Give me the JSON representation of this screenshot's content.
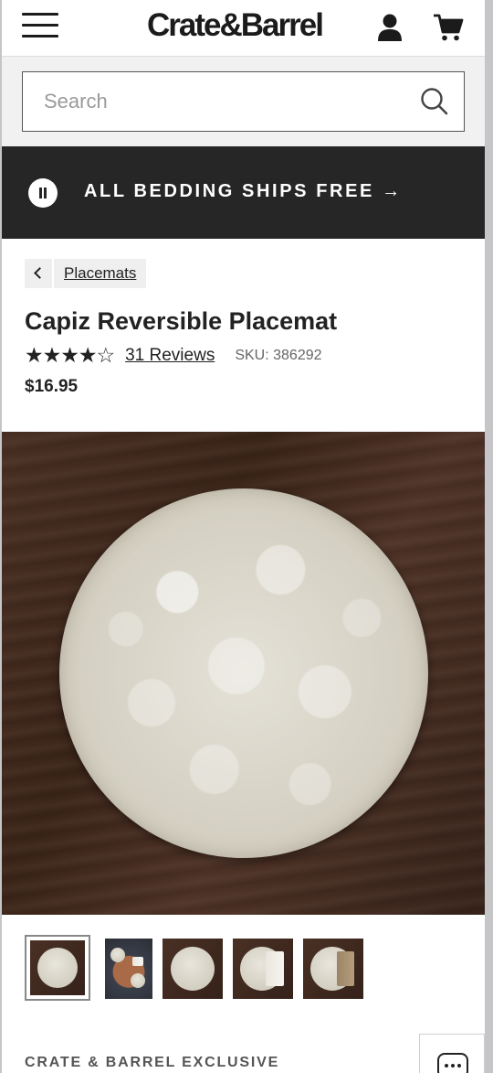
{
  "header": {
    "logo_text": "Crate&Barrel",
    "menu_icon": "hamburger-menu-icon",
    "account_icon": "user-account-icon",
    "cart_icon": "shopping-cart-icon"
  },
  "search": {
    "placeholder": "Search",
    "value": "",
    "icon": "search-icon"
  },
  "promo_banner": {
    "text": "ALL BEDDING SHIPS FREE →",
    "pause_icon": "pause-icon",
    "background_color": "#262626"
  },
  "breadcrumb": {
    "back_icon": "chevron-left-icon",
    "category_label": "Placemats"
  },
  "product": {
    "title": "Capiz Reversible Placemat",
    "rating_stars": "★★★★☆",
    "rating_value": 4.5,
    "reviews_label": "31 Reviews",
    "sku_label": "SKU: 386292",
    "price": "$16.95",
    "exclusive_label": "CRATE & BARREL EXCLUSIVE"
  },
  "gallery": {
    "main_image": "capiz-placemat-on-wood-image",
    "selected_index": 0,
    "thumbnails": [
      "placemat-top-view-thumbnail",
      "table-setting-thumbnail",
      "placemat-detail-thumbnail",
      "placemat-with-white-napkin-thumbnail",
      "placemat-with-tan-napkin-thumbnail"
    ]
  },
  "chat": {
    "icon": "chat-bubble-icon"
  }
}
